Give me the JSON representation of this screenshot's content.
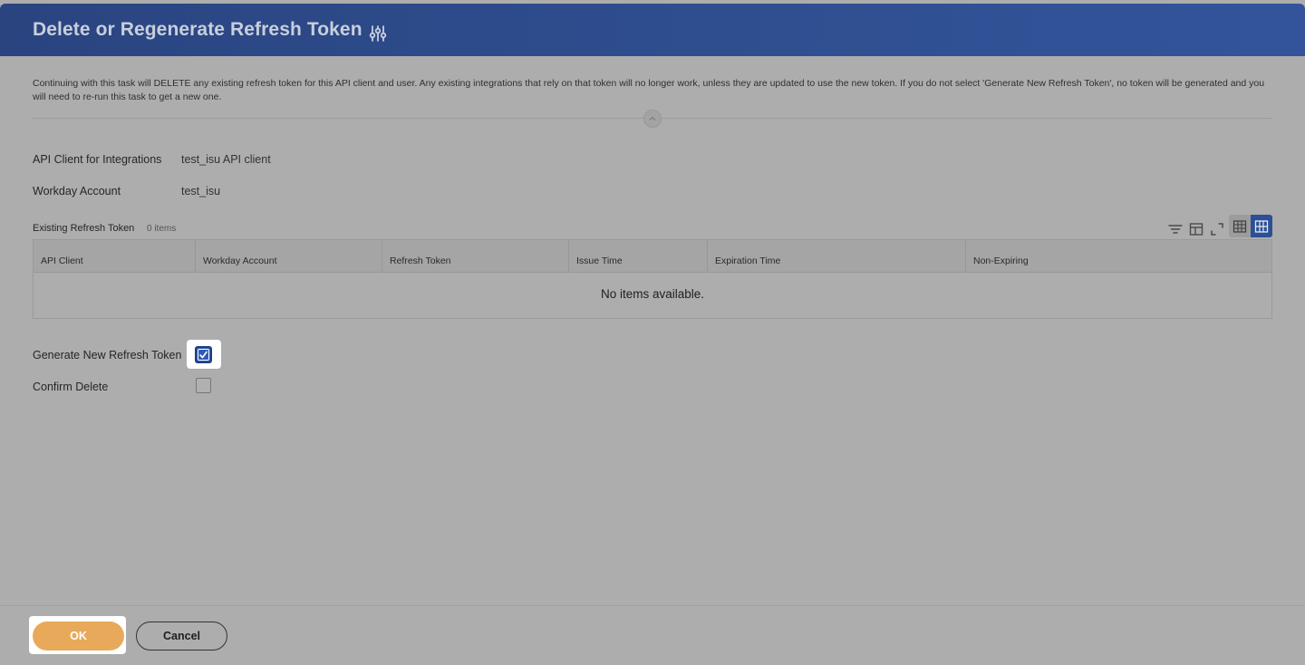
{
  "header": {
    "title": "Delete or Regenerate Refresh Token",
    "settings_icon": "sliders-icon"
  },
  "description": "Continuing with this task will DELETE any existing refresh token for this API client and user. Any existing integrations that rely on that token will no longer work, unless they are updated to use the new token. If you do not select 'Generate New Refresh Token', no token will be generated and you will need to re-run this task to get a new one.",
  "fields": {
    "api_client_label": "API Client for Integrations",
    "api_client_value": "test_isu API client",
    "workday_account_label": "Workday Account",
    "workday_account_value": "test_isu"
  },
  "grid": {
    "title": "Existing Refresh Token",
    "count": "0 items",
    "columns": [
      "API Client",
      "Workday Account",
      "Refresh Token",
      "Issue Time",
      "Expiration Time",
      "Non-Expiring"
    ],
    "empty_message": "No items available.",
    "toolbar_icons": [
      "filter-icon",
      "column-layout-icon",
      "fullscreen-icon",
      "table-view-icon",
      "grid-view-icon"
    ]
  },
  "form": {
    "generate_label": "Generate New Refresh Token",
    "generate_checked": true,
    "confirm_label": "Confirm Delete",
    "confirm_checked": false
  },
  "footer": {
    "ok_label": "OK",
    "cancel_label": "Cancel"
  },
  "colors": {
    "header": "#2f4f91",
    "ok_button": "#e8a95a",
    "checkbox_checked": "#2f5bb6"
  }
}
